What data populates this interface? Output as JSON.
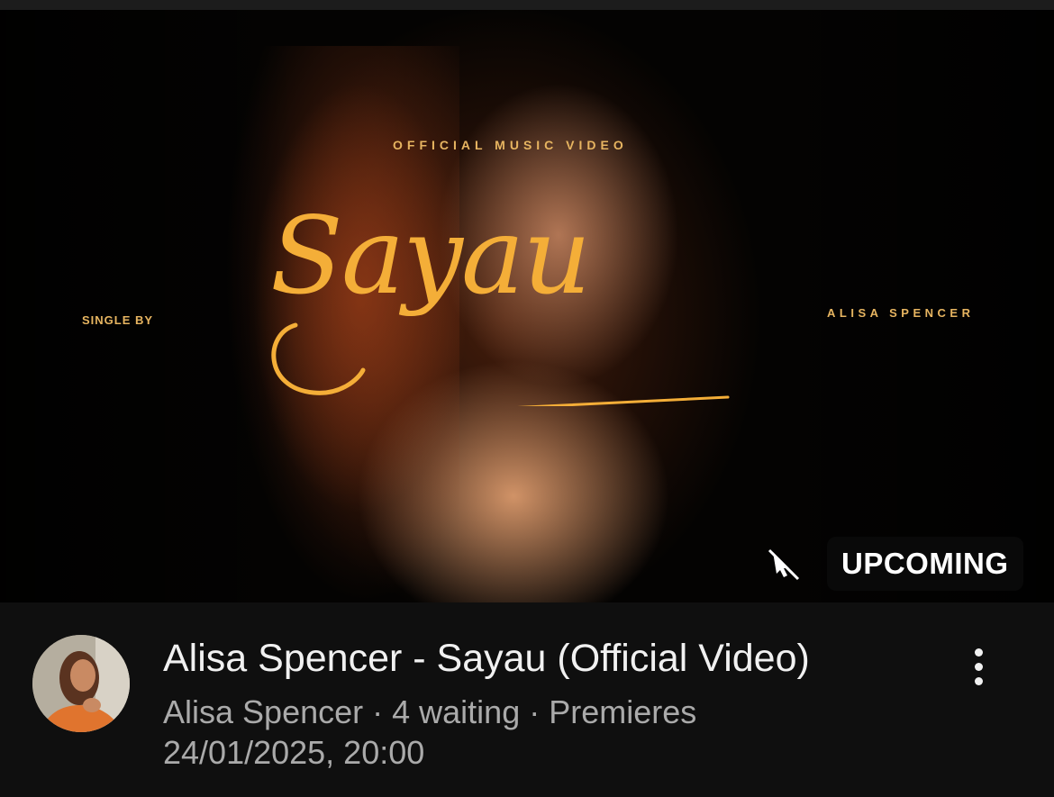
{
  "video": {
    "title": "Alisa Spencer - Sayau (Official Video)",
    "channel": "Alisa Spencer",
    "separator": " · ",
    "waiting": "4 waiting",
    "premiere_label": "Premieres",
    "premiere_datetime": "24/01/2025, 20:00"
  },
  "thumbnail": {
    "badge": "UPCOMING",
    "overlay_top": "OFFICIAL MUSIC VIDEO",
    "overlay_left": "SINGLE BY",
    "overlay_right": "ALISA SPENCER",
    "song_title": "Sayau"
  },
  "icons": {
    "more": "more-vertical-icon",
    "cursor": "cursor-off-icon"
  },
  "colors": {
    "background": "#0f0f0f",
    "title_text": "#f1f1f1",
    "meta_text": "#aaaaaa",
    "accent_gold": "#f4ae38"
  }
}
